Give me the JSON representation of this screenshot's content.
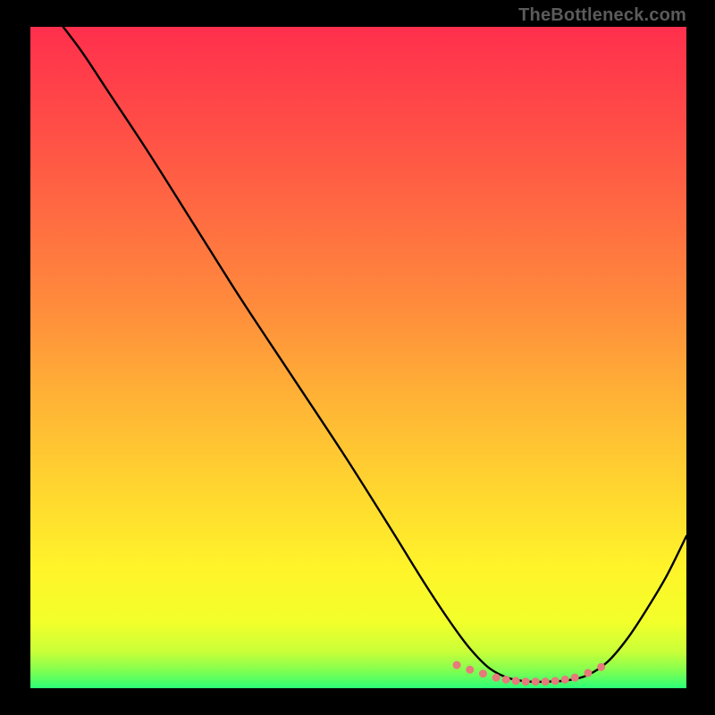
{
  "watermark": "TheBottleneck.com",
  "gradient": {
    "stops": [
      {
        "offset": 0.0,
        "color": "#ff2f4d"
      },
      {
        "offset": 0.14,
        "color": "#ff4b47"
      },
      {
        "offset": 0.28,
        "color": "#ff6a42"
      },
      {
        "offset": 0.42,
        "color": "#ff8b3c"
      },
      {
        "offset": 0.56,
        "color": "#ffb236"
      },
      {
        "offset": 0.7,
        "color": "#ffd62f"
      },
      {
        "offset": 0.82,
        "color": "#fff42a"
      },
      {
        "offset": 0.9,
        "color": "#f2ff2a"
      },
      {
        "offset": 0.945,
        "color": "#c9ff38"
      },
      {
        "offset": 0.975,
        "color": "#7dff52"
      },
      {
        "offset": 1.0,
        "color": "#2bff77"
      }
    ]
  },
  "chart_data": {
    "type": "line",
    "title": "",
    "xlabel": "",
    "ylabel": "",
    "xlim": [
      0,
      100
    ],
    "ylim": [
      0,
      100
    ],
    "series": [
      {
        "name": "bottleneck-curve",
        "x": [
          5,
          8,
          12,
          18,
          25,
          32,
          40,
          48,
          55,
          60,
          64,
          67,
          70,
          73,
          76,
          79,
          82,
          85,
          88,
          91,
          94,
          97,
          100
        ],
        "y": [
          100,
          96,
          90,
          81,
          70,
          59,
          47,
          35,
          24,
          16,
          10,
          6,
          3,
          1.5,
          1,
          1,
          1.2,
          2,
          4,
          7.5,
          12,
          17,
          23
        ]
      }
    ],
    "markers": {
      "name": "trough-dots",
      "color": "#e77a7a",
      "x": [
        65,
        67,
        69,
        71,
        72.5,
        74,
        75.5,
        77,
        78.5,
        80,
        81.5,
        83,
        85,
        87
      ],
      "y": [
        3.5,
        2.8,
        2.2,
        1.6,
        1.3,
        1.1,
        1.0,
        1.0,
        1.0,
        1.1,
        1.3,
        1.6,
        2.3,
        3.2
      ]
    }
  }
}
